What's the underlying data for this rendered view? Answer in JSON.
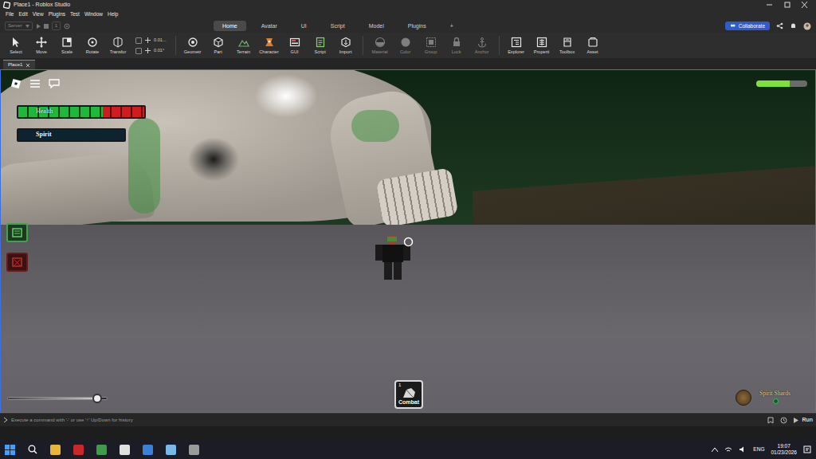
{
  "window": {
    "title": "Place1 - Roblox Studio"
  },
  "menu": [
    "File",
    "Edit",
    "View",
    "Plugins",
    "Test",
    "Window",
    "Help"
  ],
  "quick": {
    "server": "Server",
    "players": "1"
  },
  "ribbon_tabs": [
    {
      "label": "Home",
      "selected": true
    },
    {
      "label": "Avatar",
      "selected": false
    },
    {
      "label": "UI",
      "selected": false
    },
    {
      "label": "Script",
      "selected": false
    },
    {
      "label": "Model",
      "selected": false
    },
    {
      "label": "Plugins",
      "selected": false
    },
    {
      "label": "+",
      "selected": false
    }
  ],
  "collaborate": "Collaborate",
  "tools": [
    {
      "label": "Select",
      "disabled": false
    },
    {
      "label": "Move",
      "disabled": false
    },
    {
      "label": "Scale",
      "disabled": false
    },
    {
      "label": "Rotate",
      "disabled": false
    },
    {
      "label": "Transfor",
      "disabled": false
    },
    {
      "label": "Geometr",
      "disabled": false
    },
    {
      "label": "Part",
      "disabled": false
    },
    {
      "label": "Terrain",
      "disabled": false
    },
    {
      "label": "Character",
      "disabled": false
    },
    {
      "label": "GUI",
      "disabled": false
    },
    {
      "label": "Script",
      "disabled": false
    },
    {
      "label": "Import",
      "disabled": false
    },
    {
      "label": "Material",
      "disabled": true
    },
    {
      "label": "Color",
      "disabled": true
    },
    {
      "label": "Group",
      "disabled": true
    },
    {
      "label": "Lock",
      "disabled": true
    },
    {
      "label": "Anchor",
      "disabled": true
    },
    {
      "label": "Explorer",
      "disabled": false
    },
    {
      "label": "Properti",
      "disabled": false
    },
    {
      "label": "Toolbox",
      "disabled": false
    },
    {
      "label": "Asset",
      "disabled": false
    }
  ],
  "snap": {
    "move": "0.01...",
    "rotate": "0.01°"
  },
  "doc_tabs": [
    {
      "label": "Place1",
      "selected": true
    }
  ],
  "hud": {
    "health": {
      "label": "Health",
      "level": 0.67
    },
    "spirit": {
      "label": "Spirit",
      "level": 0
    },
    "stamina": {
      "level": 0.65
    },
    "volume": {
      "level": 0.9
    },
    "hotbar": [
      {
        "key": "1",
        "label": "Combat"
      }
    ],
    "currency": {
      "label": "Spirit Shards"
    }
  },
  "command_bar": {
    "placeholder": "Execute a command with '-' or use '↑' Up/Down for history"
  },
  "run": "Run",
  "taskbar": {
    "lang": "ENG",
    "time": "19:07",
    "date": "01/23/2026"
  }
}
